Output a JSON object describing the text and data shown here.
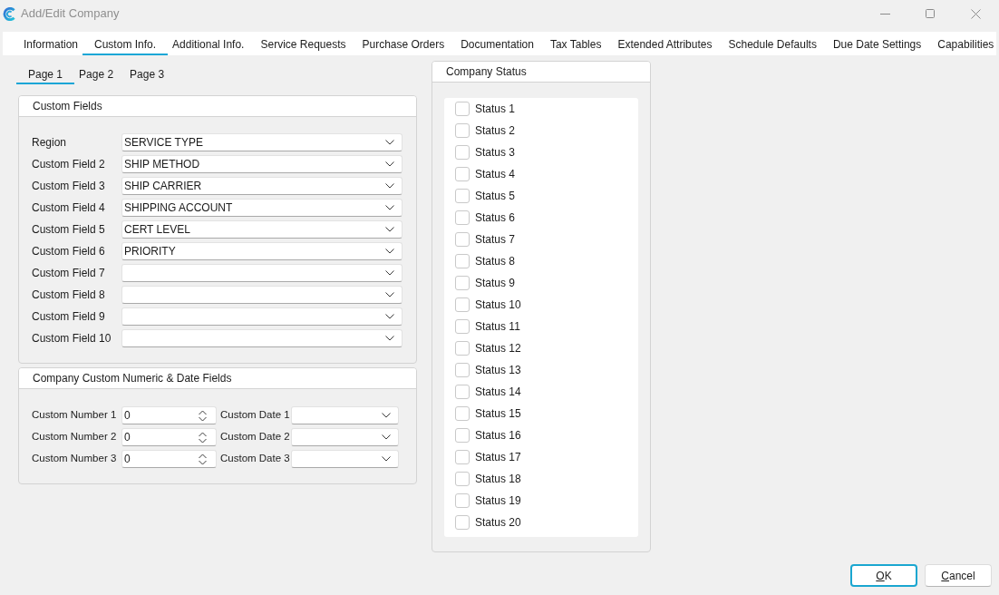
{
  "window": {
    "title": "Add/Edit Company"
  },
  "tabs": [
    {
      "label": "Information",
      "selected": false
    },
    {
      "label": "Custom Info.",
      "selected": true
    },
    {
      "label": "Additional Info.",
      "selected": false
    },
    {
      "label": "Service Requests",
      "selected": false
    },
    {
      "label": "Purchase Orders",
      "selected": false
    },
    {
      "label": "Documentation",
      "selected": false
    },
    {
      "label": "Tax Tables",
      "selected": false
    },
    {
      "label": "Extended Attributes",
      "selected": false
    },
    {
      "label": "Schedule Defaults",
      "selected": false
    },
    {
      "label": "Due Date Settings",
      "selected": false
    },
    {
      "label": "Capabilities",
      "selected": false
    }
  ],
  "page_tabs": [
    {
      "label": "Page 1",
      "selected": true
    },
    {
      "label": "Page 2",
      "selected": false
    },
    {
      "label": "Page 3",
      "selected": false
    }
  ],
  "custom_fields": {
    "title": "Custom Fields",
    "rows": [
      {
        "label": "Region",
        "value": "SERVICE TYPE"
      },
      {
        "label": "Custom Field 2",
        "value": "SHIP METHOD"
      },
      {
        "label": "Custom Field 3",
        "value": "SHIP CARRIER"
      },
      {
        "label": "Custom Field 4",
        "value": "SHIPPING ACCOUNT"
      },
      {
        "label": "Custom Field 5",
        "value": "CERT LEVEL"
      },
      {
        "label": "Custom Field 6",
        "value": "PRIORITY"
      },
      {
        "label": "Custom Field 7"
      },
      {
        "label": "Custom Field 8"
      },
      {
        "label": "Custom Field 9"
      },
      {
        "label": "Custom Field 10"
      }
    ]
  },
  "numeric_date_fields": {
    "title": "Company Custom Numeric & Date Fields",
    "rows": [
      {
        "number_label": "Custom Number 1",
        "number_value": "0",
        "date_label": "Custom Date 1"
      },
      {
        "number_label": "Custom Number 2",
        "number_value": "0",
        "date_label": "Custom Date 2"
      },
      {
        "number_label": "Custom Number 3",
        "number_value": "0",
        "date_label": "Custom Date 3"
      }
    ]
  },
  "company_status": {
    "title": "Company Status",
    "items": [
      {
        "label": "Status 1",
        "checked": false
      },
      {
        "label": "Status 2",
        "checked": false
      },
      {
        "label": "Status 3",
        "checked": false
      },
      {
        "label": "Status 4",
        "checked": false
      },
      {
        "label": "Status 5",
        "checked": false
      },
      {
        "label": "Status 6",
        "checked": false
      },
      {
        "label": "Status 7",
        "checked": false
      },
      {
        "label": "Status 8",
        "checked": false
      },
      {
        "label": "Status 9",
        "checked": false
      },
      {
        "label": "Status 10",
        "checked": false
      },
      {
        "label": "Status 11",
        "checked": false
      },
      {
        "label": "Status 12",
        "checked": false
      },
      {
        "label": "Status 13",
        "checked": false
      },
      {
        "label": "Status 14",
        "checked": false
      },
      {
        "label": "Status 15",
        "checked": false
      },
      {
        "label": "Status 16",
        "checked": false
      },
      {
        "label": "Status 17",
        "checked": false
      },
      {
        "label": "Status 18",
        "checked": false
      },
      {
        "label": "Status 19",
        "checked": false
      },
      {
        "label": "Status 20",
        "checked": false
      }
    ]
  },
  "buttons": [
    {
      "label": "OK",
      "default": true
    },
    {
      "label": "Cancel",
      "default": false
    }
  ]
}
